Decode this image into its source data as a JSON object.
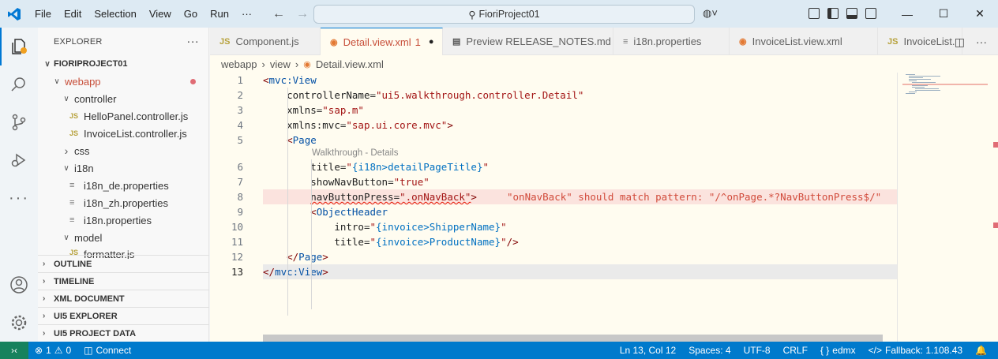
{
  "titlebar": {
    "menu": [
      "File",
      "Edit",
      "Selection",
      "View",
      "Go",
      "Run",
      "···"
    ],
    "search_text": "FioriProject01",
    "back_icon": "arrow-left-icon",
    "forward_icon": "arrow-right-icon"
  },
  "sidebar": {
    "title": "EXPLORER",
    "more": "···",
    "project": "FIORIPROJECT01",
    "tree": [
      {
        "label": "webapp",
        "kind": "folder-open",
        "indent": 1,
        "modified": true
      },
      {
        "label": "controller",
        "kind": "folder-open",
        "indent": 2
      },
      {
        "label": "HelloPanel.controller.js",
        "kind": "js",
        "indent": 3
      },
      {
        "label": "InvoiceList.controller.js",
        "kind": "js",
        "indent": 3
      },
      {
        "label": "css",
        "kind": "folder-closed",
        "indent": 2
      },
      {
        "label": "i18n",
        "kind": "folder-open",
        "indent": 2
      },
      {
        "label": "i18n_de.properties",
        "kind": "prop",
        "indent": 3
      },
      {
        "label": "i18n_zh.properties",
        "kind": "prop",
        "indent": 3
      },
      {
        "label": "i18n.properties",
        "kind": "prop",
        "indent": 3
      },
      {
        "label": "model",
        "kind": "folder-open",
        "indent": 2
      },
      {
        "label": "formatter.js",
        "kind": "js",
        "indent": 3
      }
    ],
    "sections": [
      "OUTLINE",
      "TIMELINE",
      "XML DOCUMENT",
      "UI5 EXPLORER",
      "UI5 PROJECT DATA"
    ]
  },
  "tabs": [
    {
      "label": "Component.js",
      "icon": "JS",
      "active": false
    },
    {
      "label": "Detail.view.xml",
      "badge": "1",
      "icon": "rss",
      "active": true
    },
    {
      "label": "Preview RELEASE_NOTES.md",
      "icon": "preview",
      "active": false
    },
    {
      "label": "i18n.properties",
      "icon": "prop",
      "active": false
    },
    {
      "label": "InvoiceList.view.xml",
      "icon": "rss",
      "active": false
    },
    {
      "label": "InvoiceList.",
      "icon": "JS",
      "active": false
    }
  ],
  "breadcrumb": [
    "webapp",
    "view",
    "Detail.view.xml"
  ],
  "editor": {
    "codelens": "Walkthrough - Details",
    "error_message": "\"onNavBack\" should match pattern: \"/^onPage.*?NavButtonPress$/\"",
    "lines": [
      {
        "n": "1",
        "text": "<mvc:View"
      },
      {
        "n": "2",
        "text": "    controllerName=\"ui5.walkthrough.controller.Detail\""
      },
      {
        "n": "3",
        "text": "    xmlns=\"sap.m\""
      },
      {
        "n": "4",
        "text": "    xmlns:mvc=\"sap.ui.core.mvc\">"
      },
      {
        "n": "5",
        "text": "    <Page"
      },
      {
        "n": "6",
        "text": "        title=\"{i18n>detailPageTitle}\""
      },
      {
        "n": "7",
        "text": "        showNavButton=\"true\""
      },
      {
        "n": "8",
        "text": "        navButtonPress=\".onNavBack\">"
      },
      {
        "n": "9",
        "text": "        <ObjectHeader"
      },
      {
        "n": "10",
        "text": "            intro=\"{invoice>ShipperName}\""
      },
      {
        "n": "11",
        "text": "            title=\"{invoice>ProductName}\"/>"
      },
      {
        "n": "12",
        "text": "    </Page>"
      },
      {
        "n": "13",
        "text": "</mvc:View>"
      }
    ]
  },
  "statusbar": {
    "problems": "1",
    "warnings": "0",
    "connect": "Connect",
    "position": "Ln 13, Col 12",
    "spaces": "Spaces: 4",
    "encoding": "UTF-8",
    "eol": "CRLF",
    "language": "edmx",
    "fallback": "Fallback: 1.108.43"
  },
  "colors": {
    "accent": "#007acc",
    "error": "#d14a3a",
    "editor_bg": "#fffcf0"
  }
}
